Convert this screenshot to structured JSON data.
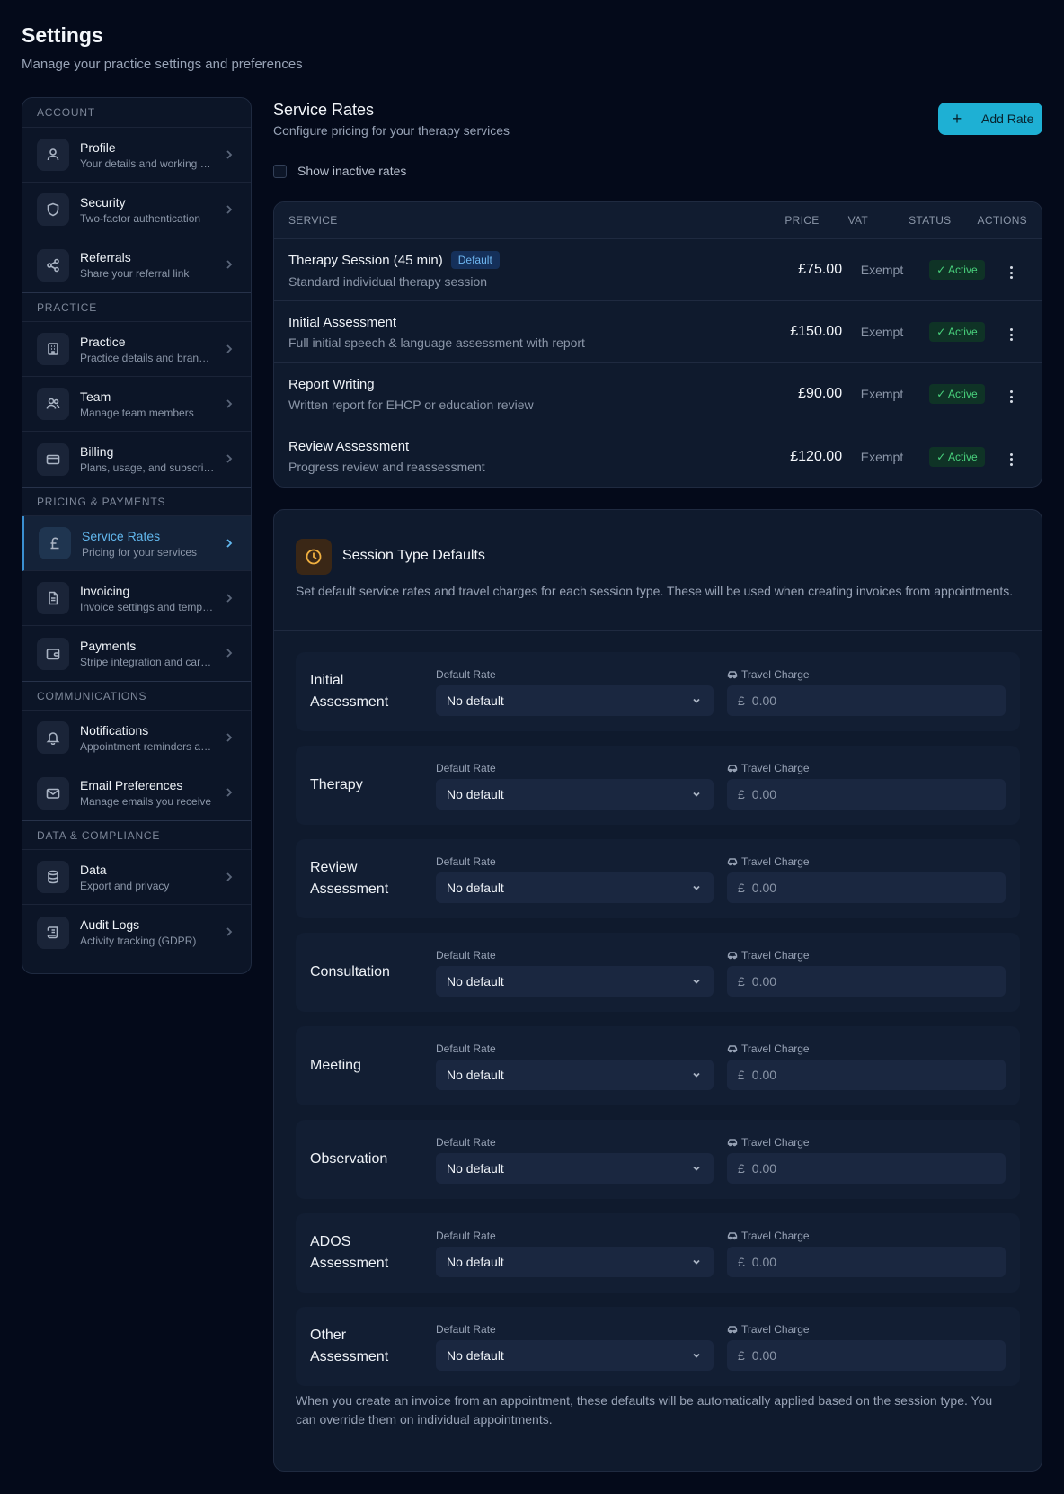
{
  "header": {
    "title": "Settings",
    "subtitle": "Manage your practice settings and preferences"
  },
  "sidebar": {
    "sections": [
      {
        "title": "Account",
        "items": [
          {
            "label": "Profile",
            "desc": "Your details and working hours",
            "icon": "user-icon"
          },
          {
            "label": "Security",
            "desc": "Two-factor authentication",
            "icon": "shield-icon"
          },
          {
            "label": "Referrals",
            "desc": "Share your referral link",
            "icon": "share-icon"
          }
        ]
      },
      {
        "title": "Practice",
        "items": [
          {
            "label": "Practice",
            "desc": "Practice details and branding",
            "icon": "building-icon"
          },
          {
            "label": "Team",
            "desc": "Manage team members",
            "icon": "users-icon"
          },
          {
            "label": "Billing",
            "desc": "Plans, usage, and subscriptions",
            "icon": "credit-card-icon"
          }
        ]
      },
      {
        "title": "Pricing & Payments",
        "items": [
          {
            "label": "Service Rates",
            "desc": "Pricing for your services",
            "icon": "pound-icon"
          },
          {
            "label": "Invoicing",
            "desc": "Invoice settings and templates",
            "icon": "document-icon"
          },
          {
            "label": "Payments",
            "desc": "Stripe integration and card payments",
            "icon": "wallet-icon"
          }
        ]
      },
      {
        "title": "Communications",
        "items": [
          {
            "label": "Notifications",
            "desc": "Appointment reminders and alerts",
            "icon": "bell-icon"
          },
          {
            "label": "Email Preferences",
            "desc": "Manage emails you receive",
            "icon": "mail-icon"
          }
        ]
      },
      {
        "title": "Data & Compliance",
        "items": [
          {
            "label": "Data",
            "desc": "Export and privacy",
            "icon": "database-icon"
          },
          {
            "label": "Audit Logs",
            "desc": "Activity tracking (GDPR)",
            "icon": "scroll-icon"
          }
        ]
      }
    ]
  },
  "rates": {
    "title": "Service Rates",
    "subtitle": "Configure pricing for your therapy services",
    "add_label": "Add Rate",
    "show_inactive_label": "Show inactive rates",
    "columns": {
      "service": "Service",
      "price": "Price",
      "vat": "VAT",
      "status": "Status",
      "actions": "Actions"
    },
    "default_badge": "Default",
    "rows": [
      {
        "name": "Therapy Session (45 min)",
        "desc": "Standard individual therapy session",
        "price": "£75.00",
        "vat": "Exempt",
        "status": "Active"
      },
      {
        "name": "Initial Assessment",
        "desc": "Full initial speech & language assessment with report",
        "price": "£150.00",
        "vat": "Exempt",
        "status": "Active"
      },
      {
        "name": "Report Writing",
        "desc": "Written report for EHCP or education review",
        "price": "£90.00",
        "vat": "Exempt",
        "status": "Active"
      },
      {
        "name": "Review Assessment",
        "desc": "Progress review and reassessment",
        "price": "£120.00",
        "vat": "Exempt",
        "status": "Active"
      }
    ]
  },
  "session_defaults": {
    "title": "Session Type Defaults",
    "description": "Set default service rates and travel charges for each session type. These will be used when creating invoices from appointments.",
    "rate_label": "Default Rate",
    "travel_label": "Travel Charge",
    "select_value": "No default",
    "currency": "£",
    "amount_placeholder": "0.00",
    "types": [
      "Initial Assessment",
      "Therapy",
      "Review Assessment",
      "Consultation",
      "Meeting",
      "Observation",
      "ADOS Assessment",
      "Other Assessment"
    ],
    "footnote": "When you create an invoice from an appointment, these defaults will be automatically applied based on the session type. You can override them on individual appointments."
  },
  "colors": {
    "accent": "#1eb0d4",
    "active_nav": "#62b8ee",
    "status_active": "#49d27d",
    "clock": "#f0b040"
  }
}
